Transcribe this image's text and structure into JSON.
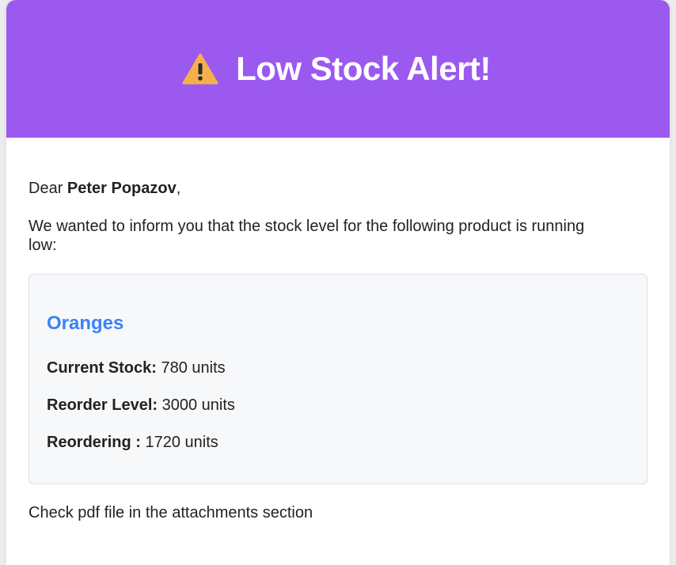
{
  "header": {
    "icon": "warning-icon",
    "title": "Low Stock Alert!",
    "background": "#9b59f0"
  },
  "greeting": {
    "prefix": "Dear ",
    "name": "Peter Popazov",
    "suffix": ","
  },
  "intro": "We wanted to inform you that the stock level for the following product is running low:",
  "product": {
    "name": "Oranges",
    "name_color": "#3b82f6",
    "rows": [
      {
        "label": "Current Stock:",
        "value": " 780 units"
      },
      {
        "label": "Reorder Level:",
        "value": " 3000 units"
      },
      {
        "label": "Reordering :",
        "value": " 1720 units"
      }
    ]
  },
  "footer_note": "Check pdf file in the attachments section"
}
